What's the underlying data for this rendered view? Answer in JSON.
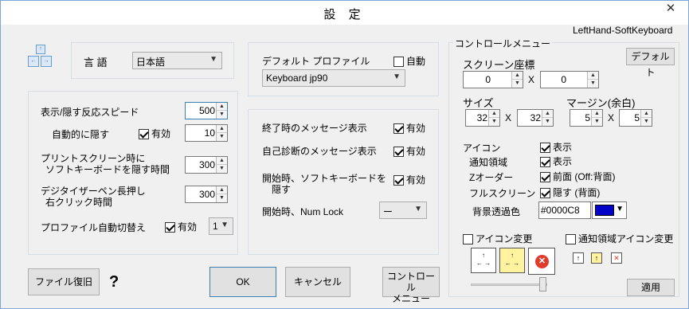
{
  "window": {
    "title": "設 定",
    "close_label": "✕"
  },
  "app_name": "LeftHand-SoftKeyboard",
  "language": {
    "label": "言 語",
    "value": "日本語"
  },
  "timing": {
    "show_hide_speed_label": "表示/隠す反応スピード",
    "show_hide_speed_value": "500",
    "auto_hide_label": "自動的に隠す",
    "auto_hide_enabled_label": "有効",
    "auto_hide_value": "10",
    "printscreen_label_1": "プリントスクリーン時に",
    "printscreen_label_2": "ソフトキーボードを隠す時間",
    "printscreen_value": "300",
    "digitizer_label_1": "デジタイザーペン長押し",
    "digitizer_label_2": "右クリック時間",
    "digitizer_value": "300",
    "profile_switch_label": "プロファイル自動切替え",
    "profile_switch_enabled_label": "有効",
    "profile_switch_value": "1"
  },
  "profile": {
    "label": "デフォルト プロファイル",
    "auto_label": "自動",
    "value": "Keyboard jp90"
  },
  "messages": {
    "exit_label": "終了時のメッセージ表示",
    "exit_enabled_label": "有効",
    "selfdiag_label": "自己診断のメッセージ表示",
    "selfdiag_enabled_label": "有効",
    "start_hide_label_1": "開始時、ソフトキーボードを",
    "start_hide_label_2": "隠す",
    "start_hide_enabled_label": "有効",
    "numlock_label": "開始時、Num Lock",
    "numlock_value": "ー"
  },
  "control_menu": {
    "group_title": "コントロールメニュー",
    "default_button": "デフォルト",
    "screen_pos_label": "スクリーン座標",
    "pos_x": "0",
    "pos_y": "0",
    "x_sep": "X",
    "size_label": "サイズ",
    "size_w": "32",
    "size_h": "32",
    "margin_label": "マージン(余白)",
    "margin_x": "5",
    "margin_y": "5",
    "icon_label": "アイコン",
    "icon_show_label": "表示",
    "notify_area_label": "通知領域",
    "notify_show_label": "表示",
    "zorder_label": "Zオーダー",
    "zorder_value_label": "前面 (Off:背面)",
    "fullscreen_label": "フルスクリーン",
    "fullscreen_value_label": "隠す (背面)",
    "bg_alpha_label": "背景透過色",
    "bg_alpha_value": "#0000C8",
    "bg_alpha_color": "#0000c8",
    "icon_change_label": "アイコン変更",
    "notify_icon_change_label": "通知領域アイコン変更",
    "apply_button": "適用"
  },
  "buttons": {
    "restore_file": "ファイル復旧",
    "help": "?",
    "ok": "OK",
    "cancel": "キャンセル",
    "control_menu_1": "コントロール",
    "control_menu_2": "メニュー"
  }
}
